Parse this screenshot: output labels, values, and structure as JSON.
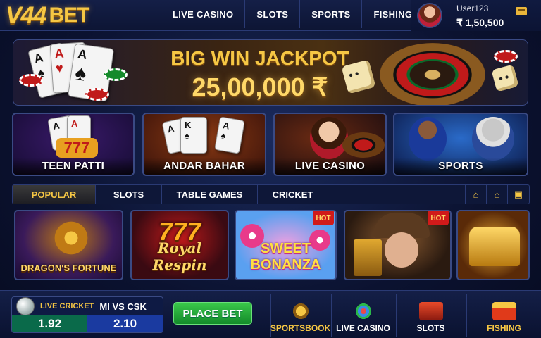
{
  "header": {
    "logo": {
      "main": "V44",
      "suffix": "BET"
    },
    "nav": [
      {
        "label": "LIVE CASINO"
      },
      {
        "label": "SLOTS"
      },
      {
        "label": "SPORTS"
      },
      {
        "label": "FISHING"
      }
    ],
    "user": {
      "name": "User123",
      "balance": "₹ 1,50,500"
    }
  },
  "banner": {
    "title": "BIG WIN JACKPOT",
    "amount": "25,00,000 ₹"
  },
  "categories": [
    {
      "label": "TEEN PATTI"
    },
    {
      "label": "ANDAR BAHAR"
    },
    {
      "label": "LIVE CASINO"
    },
    {
      "label": "SPORTS"
    }
  ],
  "tabs": {
    "items": [
      {
        "label": "POPULAR",
        "active": true
      },
      {
        "label": "SLOTS"
      },
      {
        "label": "TABLE GAMES"
      },
      {
        "label": "CRICKET"
      }
    ],
    "icons": [
      "home-alert-icon",
      "home-icon",
      "chat-icon"
    ]
  },
  "games": [
    {
      "title": "DRAGON'S FORTUNE"
    },
    {
      "title": "Royal Respin",
      "numbers": "777"
    },
    {
      "title": "SWEET BONANZA",
      "badge": "HOT"
    },
    {
      "title": "",
      "badge": "HOT"
    },
    {
      "title": ""
    }
  ],
  "bottom": {
    "bet": {
      "label": "LIVE CRICKET",
      "match": "MI VS CSK",
      "odds_a": "1.92",
      "odds_b": "2.10"
    },
    "place_bet": "PLACE BET",
    "nav": [
      {
        "label": "SPORTSBOOK",
        "icon": "sportsbook-icon"
      },
      {
        "label": "LIVE CASINO",
        "icon": "live-casino-icon"
      },
      {
        "label": "SLOTS",
        "icon": "slots-icon"
      },
      {
        "label": "FISHING",
        "icon": "fishing-icon"
      }
    ]
  },
  "colors": {
    "accent": "#f6c744",
    "background": "#0b1230",
    "success": "#138a2a"
  }
}
